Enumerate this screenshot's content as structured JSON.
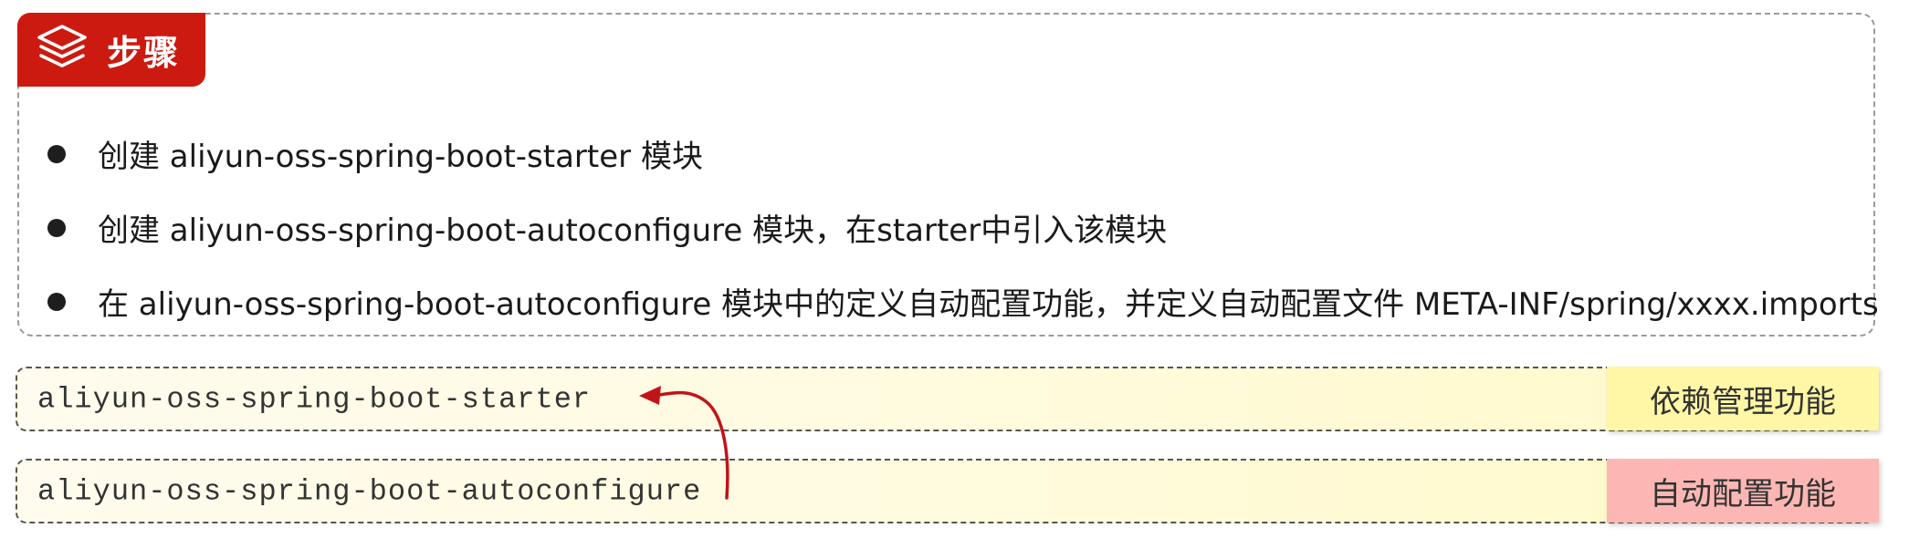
{
  "steps": {
    "title": "步骤",
    "icon": "layers-icon",
    "accent_color": "#cc1a10",
    "items": [
      "创建 aliyun-oss-spring-boot-starter 模块",
      "创建 aliyun-oss-spring-boot-autoconfigure 模块，在starter中引入该模块",
      "在 aliyun-oss-spring-boot-autoconfigure 模块中的定义自动配置功能，并定义自动配置文件 META-INF/spring/xxxx.imports"
    ]
  },
  "modules": [
    {
      "name": "aliyun-oss-spring-boot-starter",
      "tag": "依赖管理功能",
      "tag_color": "#fff7a6"
    },
    {
      "name": "aliyun-oss-spring-boot-autoconfigure",
      "tag": "自动配置功能",
      "tag_color": "#fcb7b4"
    }
  ],
  "arrow_color": "#c0141a"
}
